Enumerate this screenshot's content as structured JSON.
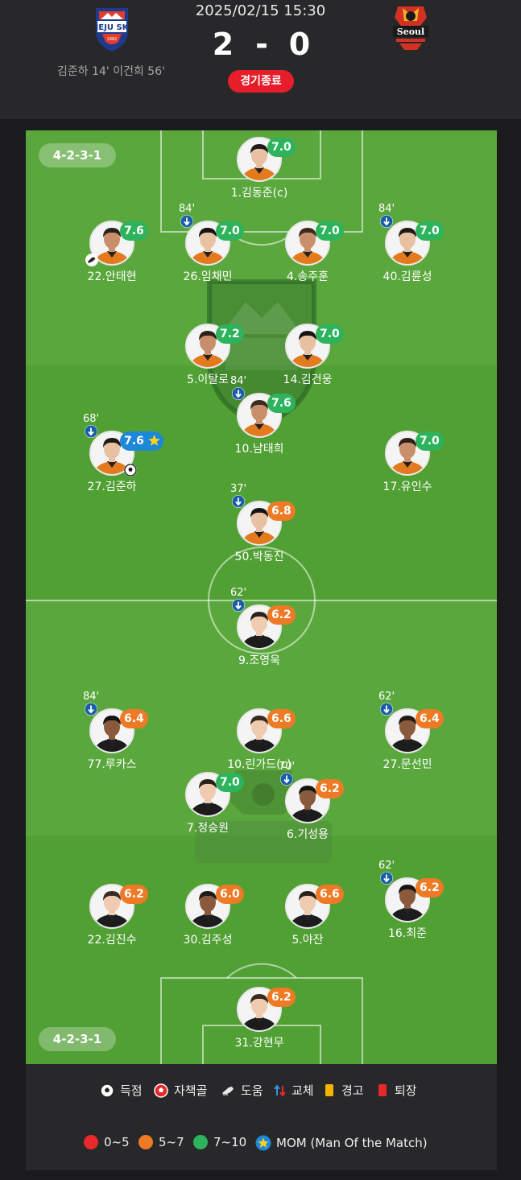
{
  "header": {
    "datetime": "2025/02/15 15:30",
    "home_team": "JEJU SK",
    "home_since": "1982",
    "away_team": "Seoul",
    "home_score": "2",
    "score_separator": "-",
    "away_score": "0",
    "scorers": "김준하 14' 이건희 56'",
    "status": "경기종료"
  },
  "home": {
    "formation": "4-2-3-1",
    "players": [
      {
        "name": "1.김동준(c)",
        "rating": "7.0",
        "tier": "green"
      },
      {
        "name": "22.안태현",
        "rating": "7.6",
        "tier": "green",
        "assist": true
      },
      {
        "name": "26.임채민",
        "rating": "7.0",
        "tier": "green",
        "sub": "84'"
      },
      {
        "name": "4.송주훈",
        "rating": "7.0",
        "tier": "green"
      },
      {
        "name": "40.김륜성",
        "rating": "7.0",
        "tier": "green",
        "sub": "84'"
      },
      {
        "name": "5.이탈로",
        "rating": "7.2",
        "tier": "green"
      },
      {
        "name": "14.김건웅",
        "rating": "7.0",
        "tier": "green"
      },
      {
        "name": "10.남태희",
        "rating": "7.6",
        "tier": "green",
        "sub": "84'"
      },
      {
        "name": "27.김준하",
        "rating": "7.6",
        "tier": "mom",
        "sub": "68'",
        "goal": true
      },
      {
        "name": "17.유인수",
        "rating": "7.0",
        "tier": "green"
      },
      {
        "name": "50.박동진",
        "rating": "6.8",
        "tier": "orange",
        "sub": "37'"
      }
    ]
  },
  "away": {
    "formation": "4-2-3-1",
    "players": [
      {
        "name": "9.조영욱",
        "rating": "6.2",
        "tier": "orange",
        "sub": "62'"
      },
      {
        "name": "77.루카스",
        "rating": "6.4",
        "tier": "orange",
        "sub": "84'"
      },
      {
        "name": "10.린가드(c)",
        "rating": "6.6",
        "tier": "orange"
      },
      {
        "name": "27.문선민",
        "rating": "6.4",
        "tier": "orange",
        "sub": "62'"
      },
      {
        "name": "7.정승원",
        "rating": "7.0",
        "tier": "green"
      },
      {
        "name": "6.기성용",
        "rating": "6.2",
        "tier": "orange",
        "sub": "70'"
      },
      {
        "name": "22.김진수",
        "rating": "6.2",
        "tier": "orange"
      },
      {
        "name": "30.김주성",
        "rating": "6.0",
        "tier": "orange"
      },
      {
        "name": "5.야잔",
        "rating": "6.6",
        "tier": "orange"
      },
      {
        "name": "16.최준",
        "rating": "6.2",
        "tier": "orange",
        "sub": "62'"
      },
      {
        "name": "31.강현무",
        "rating": "6.2",
        "tier": "orange"
      }
    ]
  },
  "legend": {
    "goal": "득점",
    "own_goal": "자책골",
    "assist": "도움",
    "sub": "교체",
    "yellow": "경고",
    "red": "퇴장",
    "range_low": "0~5",
    "range_mid": "5~7",
    "range_high": "7~10",
    "mom": "MOM (Man Of the Match)"
  },
  "colors": {
    "rating_green": "#2cb35b",
    "rating_orange": "#ee7a25",
    "rating_red": "#e8282a",
    "mom_blue": "#1d88d8",
    "status_red": "#e61e29",
    "pitch_green": "#57a33a"
  }
}
